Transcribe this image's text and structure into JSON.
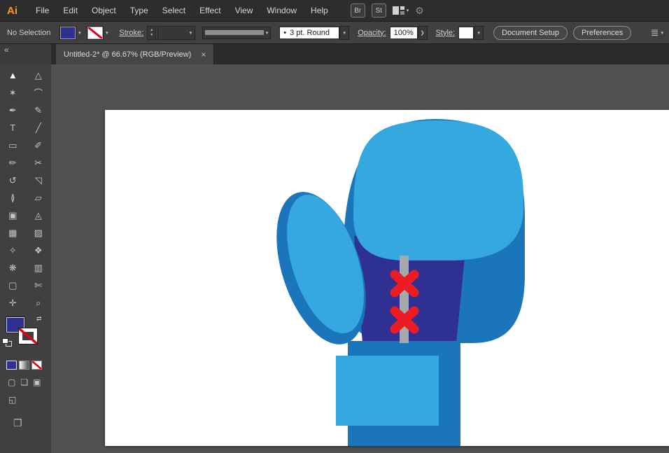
{
  "app": {
    "logo_text": "Ai"
  },
  "icons": {
    "caret_down": "▾",
    "caret_up": "▴",
    "caret_right": "❯",
    "swap": "⇄",
    "panel_menu": "≣",
    "sync_gear": "⚙",
    "bullet": "•"
  },
  "menubar": {
    "menus": [
      "File",
      "Edit",
      "Object",
      "Type",
      "Select",
      "Effect",
      "View",
      "Window",
      "Help"
    ],
    "br_button": "Br",
    "st_button": "St"
  },
  "controlbar": {
    "selection_status": "No Selection",
    "stroke_label": "Stroke:",
    "brush_name": "3 pt. Round",
    "opacity_label": "Opacity:",
    "opacity_value": "100%",
    "style_label": "Style:",
    "document_setup_button": "Document Setup",
    "preferences_button": "Preferences"
  },
  "tabbar": {
    "collapse_glyph": "«",
    "tab_title": "Untitled-2* @ 66.67% (RGB/Preview)",
    "close_glyph": "×"
  },
  "toolbar": {
    "tools": [
      {
        "name": "selection",
        "glyph": "▲"
      },
      {
        "name": "direct-selection",
        "glyph": "△"
      },
      {
        "name": "magic-wand",
        "glyph": "✶"
      },
      {
        "name": "lasso",
        "glyph": "⌒"
      },
      {
        "name": "pen",
        "glyph": "✒"
      },
      {
        "name": "curvature",
        "glyph": "✎"
      },
      {
        "name": "type",
        "glyph": "T"
      },
      {
        "name": "line-segment",
        "glyph": "╱"
      },
      {
        "name": "rectangle",
        "glyph": "▭"
      },
      {
        "name": "paintbrush",
        "glyph": "✐"
      },
      {
        "name": "pencil",
        "glyph": "✏"
      },
      {
        "name": "scissors",
        "glyph": "✂"
      },
      {
        "name": "rotate",
        "glyph": "↺"
      },
      {
        "name": "scale",
        "glyph": "◹"
      },
      {
        "name": "width",
        "glyph": "≬"
      },
      {
        "name": "free-transform",
        "glyph": "▱"
      },
      {
        "name": "shape-builder",
        "glyph": "▣"
      },
      {
        "name": "perspective-grid",
        "glyph": "◬"
      },
      {
        "name": "mesh",
        "glyph": "▦"
      },
      {
        "name": "gradient",
        "glyph": "▨"
      },
      {
        "name": "eyedropper",
        "glyph": "✧"
      },
      {
        "name": "blend",
        "glyph": "❖"
      },
      {
        "name": "symbol-sprayer",
        "glyph": "❋"
      },
      {
        "name": "column-graph",
        "glyph": "▥"
      },
      {
        "name": "artboard-tool",
        "glyph": "▢"
      },
      {
        "name": "slice",
        "glyph": "✄"
      },
      {
        "name": "hand",
        "glyph": "✛"
      },
      {
        "name": "zoom",
        "glyph": "⌕"
      }
    ],
    "mode_normal_glyph": "▢",
    "mode_behind_glyph": "❏",
    "mode_inside_glyph": "▣",
    "screen_mode_glyph": "◱",
    "panel_glyph": "❐"
  },
  "artwork": {
    "name": "boxing glove",
    "colors": {
      "light_blue": "#35a8e0",
      "dark_blue": "#1b75bb",
      "purple": "#2e3192",
      "lace_gray": "#a6a8ab",
      "stitch_red": "#ec1c24"
    }
  },
  "colors": {
    "fill_swatch": "#2e3192",
    "canvas_bg": "#515151"
  }
}
